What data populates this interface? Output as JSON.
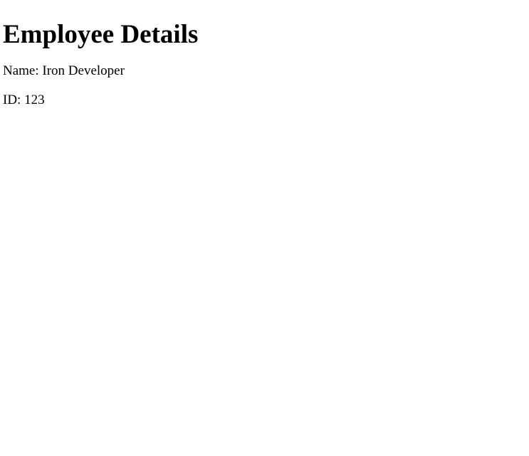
{
  "heading": "Employee Details",
  "name_line": "Name: Iron Developer",
  "id_line": "ID: 123"
}
